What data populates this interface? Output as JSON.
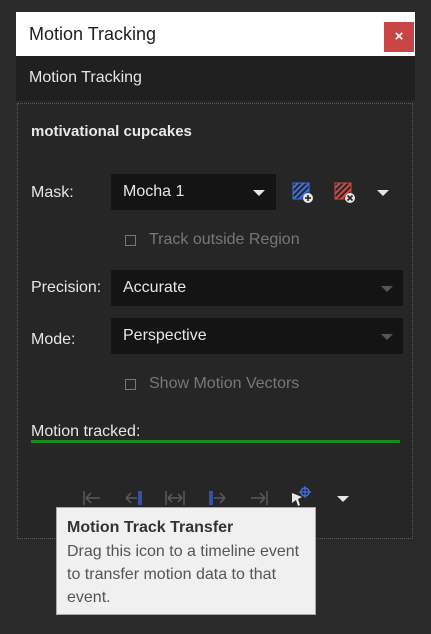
{
  "window": {
    "title": "Motion Tracking",
    "close_glyph": "×"
  },
  "header": {
    "title": "Motion Tracking"
  },
  "panel": {
    "event_name": "motivational cupcakes",
    "mask": {
      "label": "Mask:",
      "value": "Mocha 1",
      "icons": [
        "add-mask-icon",
        "remove-mask-icon"
      ],
      "menu_icon": "chevron-down-icon"
    },
    "track_outside": {
      "label": "Track outside Region",
      "checked": false,
      "enabled": false
    },
    "precision": {
      "label": "Precision:",
      "value": "Accurate"
    },
    "mode": {
      "label": "Mode:",
      "value": "Perspective"
    },
    "show_vectors": {
      "label": "Show Motion Vectors",
      "checked": false,
      "enabled": false
    },
    "status": {
      "label": "Motion tracked:",
      "progress": 1.0,
      "progress_color": "#1a8a1a"
    },
    "toolbar": {
      "icons": [
        "go-to-start-icon",
        "track-backward-icon",
        "track-bidirectional-icon",
        "track-forward-icon",
        "go-to-end-icon",
        "motion-track-transfer-icon",
        "chevron-down-icon"
      ]
    }
  },
  "tooltip": {
    "title": "Motion Track Transfer",
    "body": "Drag this icon to a timeline event to transfer motion data to that event."
  },
  "colors": {
    "close_button": "#c94444",
    "accent_blue": "#3f6fe0",
    "accent_red": "#d04848"
  }
}
